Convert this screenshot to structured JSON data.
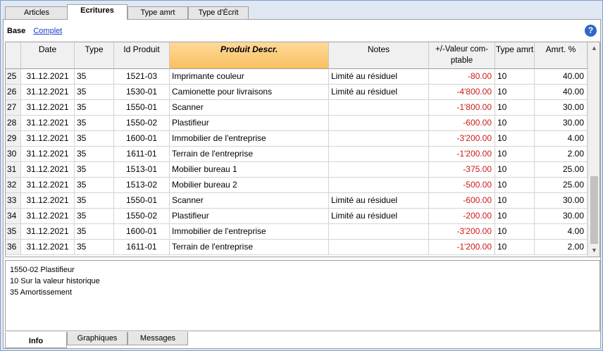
{
  "top_tabs": [
    "Articles",
    "Ecritures",
    "Type amrt",
    "Type d'Écrit"
  ],
  "views": {
    "base": "Base",
    "complet": "Complet"
  },
  "help_icon": "question-mark-icon",
  "help_glyph": "?",
  "columns": [
    "",
    "Date",
    "Type",
    "Id Produit",
    "Produit Descr.",
    "Notes",
    "+/-Valeur com-ptable",
    "Type amrt",
    "Amrt. %"
  ],
  "column_lines": {
    "valeur": [
      "+/-Valeur com-",
      "ptable"
    ]
  },
  "rows": [
    {
      "n": "25",
      "date": "31.12.2021",
      "type": "35",
      "id": "1521-03",
      "descr": "Imprimante couleur",
      "notes": "Limité au résiduel",
      "valeur": "-80.00",
      "tamrt": "10",
      "pct": "40.00"
    },
    {
      "n": "26",
      "date": "31.12.2021",
      "type": "35",
      "id": "1530-01",
      "descr": "Camionette pour livraisons",
      "notes": "Limité au résiduel",
      "valeur": "-4'800.00",
      "tamrt": "10",
      "pct": "40.00"
    },
    {
      "n": "27",
      "date": "31.12.2021",
      "type": "35",
      "id": "1550-01",
      "descr": "Scanner",
      "notes": "",
      "valeur": "-1'800.00",
      "tamrt": "10",
      "pct": "30.00"
    },
    {
      "n": "28",
      "date": "31.12.2021",
      "type": "35",
      "id": "1550-02",
      "descr": "Plastifieur",
      "notes": "",
      "valeur": "-600.00",
      "tamrt": "10",
      "pct": "30.00"
    },
    {
      "n": "29",
      "date": "31.12.2021",
      "type": "35",
      "id": "1600-01",
      "descr": "Immobilier de l'entreprise",
      "notes": "",
      "valeur": "-3'200.00",
      "tamrt": "10",
      "pct": "4.00"
    },
    {
      "n": "30",
      "date": "31.12.2021",
      "type": "35",
      "id": "1611-01",
      "descr": "Terrain de l'entreprise",
      "notes": "",
      "valeur": "-1'200.00",
      "tamrt": "10",
      "pct": "2.00"
    },
    {
      "n": "31",
      "date": "31.12.2021",
      "type": "35",
      "id": "1513-01",
      "descr": "Mobilier bureau 1",
      "notes": "",
      "valeur": "-375.00",
      "tamrt": "10",
      "pct": "25.00"
    },
    {
      "n": "32",
      "date": "31.12.2021",
      "type": "35",
      "id": "1513-02",
      "descr": "Mobilier bureau 2",
      "notes": "",
      "valeur": "-500.00",
      "tamrt": "10",
      "pct": "25.00"
    },
    {
      "n": "33",
      "date": "31.12.2021",
      "type": "35",
      "id": "1550-01",
      "descr": "Scanner",
      "notes": "Limité au résiduel",
      "valeur": "-600.00",
      "tamrt": "10",
      "pct": "30.00"
    },
    {
      "n": "34",
      "date": "31.12.2021",
      "type": "35",
      "id": "1550-02",
      "descr": "Plastifieur",
      "notes": "Limité au résiduel",
      "valeur": "-200.00",
      "tamrt": "10",
      "pct": "30.00"
    },
    {
      "n": "35",
      "date": "31.12.2021",
      "type": "35",
      "id": "1600-01",
      "descr": "Immobilier de l'entreprise",
      "notes": "",
      "valeur": "-3'200.00",
      "tamrt": "10",
      "pct": "4.00"
    },
    {
      "n": "36",
      "date": "31.12.2021",
      "type": "35",
      "id": "1611-01",
      "descr": "Terrain de l'entreprise",
      "notes": "",
      "valeur": "-1'200.00",
      "tamrt": "10",
      "pct": "2.00"
    }
  ],
  "info_lines": [
    "1550-02 Plastifieur",
    "10 Sur la valeur historique",
    "35 Amortissement"
  ],
  "bottom_tabs": [
    "Info",
    "Graphiques",
    "Messages"
  ],
  "colors": {
    "negative_value": "#d01818",
    "selected_header": "#f7c060",
    "link": "#1a3ec8"
  }
}
